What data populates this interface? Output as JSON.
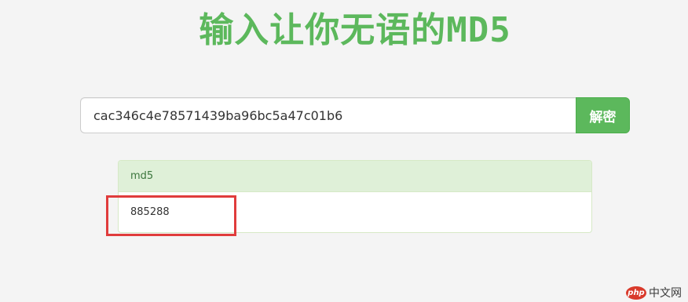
{
  "header": {
    "title": "输入让你无语的MD5"
  },
  "search": {
    "value": "cac346c4e78571439ba96bc5a47c01b6",
    "button_label": "解密"
  },
  "result": {
    "heading": "md5",
    "value": "885288"
  },
  "watermark": {
    "logo": "php",
    "text": "中文网"
  },
  "colors": {
    "accent": "#5cb85c",
    "panel_heading_bg": "#dff0d8",
    "highlight": "#e03c3c",
    "background": "#f4f4f4"
  }
}
